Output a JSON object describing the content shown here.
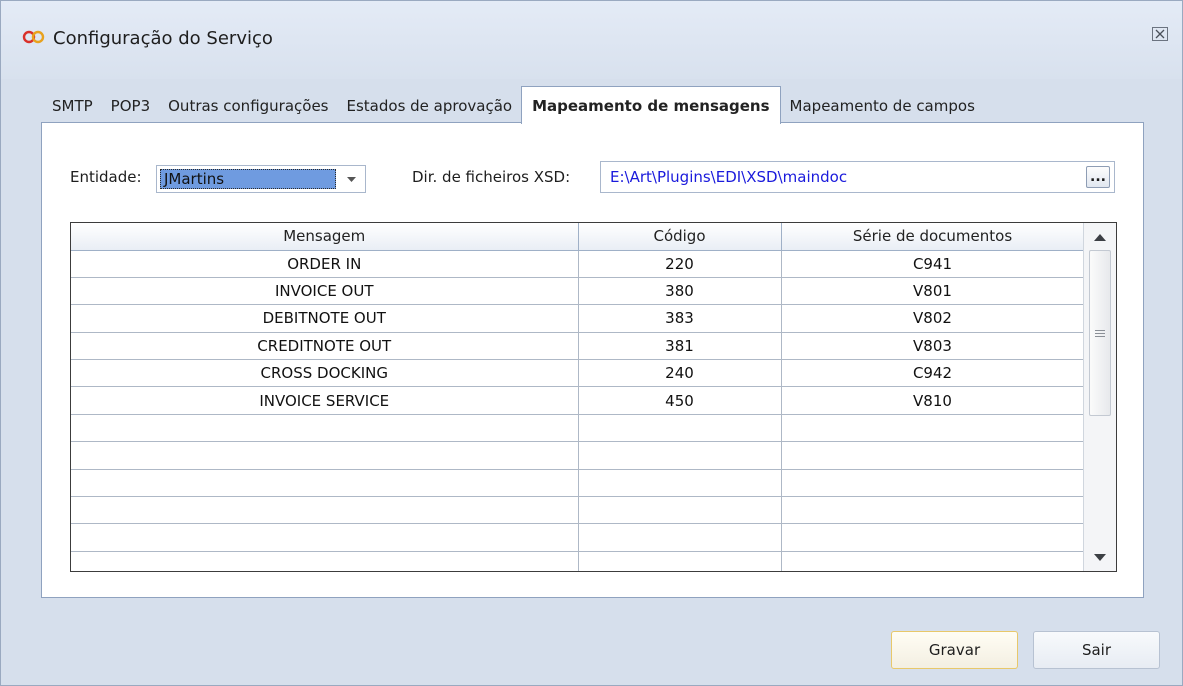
{
  "window": {
    "title": "Configuração do Serviço",
    "accent_icon_color": "#d9302a"
  },
  "tabs": [
    {
      "label": "SMTP",
      "active": false
    },
    {
      "label": "POP3",
      "active": false
    },
    {
      "label": "Outras configurações",
      "active": false
    },
    {
      "label": "Estados de aprovação",
      "active": false
    },
    {
      "label": "Mapeamento de mensagens",
      "active": true
    },
    {
      "label": "Mapeamento de campos",
      "active": false
    }
  ],
  "form": {
    "entity_label": "Entidade:",
    "entity_value": "JMartins",
    "xsd_dir_label": "Dir. de ficheiros XSD:",
    "xsd_dir_value": "E:\\Art\\Plugins\\EDI\\XSD\\maindoc",
    "browse_label": "..."
  },
  "grid": {
    "columns": [
      "Mensagem",
      "Código",
      "Série de documentos"
    ],
    "rows": [
      [
        "ORDER IN",
        "220",
        "C941"
      ],
      [
        "INVOICE OUT",
        "380",
        "V801"
      ],
      [
        "DEBITNOTE OUT",
        "383",
        "V802"
      ],
      [
        "CREDITNOTE OUT",
        "381",
        "V803"
      ],
      [
        "CROSS DOCKING",
        "240",
        "C942"
      ],
      [
        "INVOICE SERVICE",
        "450",
        "V810"
      ]
    ]
  },
  "buttons": {
    "save": "Gravar",
    "exit": "Sair"
  }
}
